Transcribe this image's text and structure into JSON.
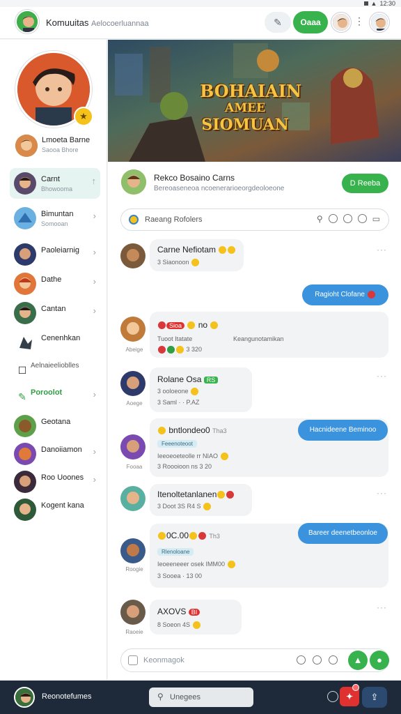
{
  "status": {
    "time": "12:30",
    "indicator": "▲"
  },
  "header": {
    "title": "Komuuitas",
    "subtitle": "Ael​ocoerluannaa",
    "pin_icon": "pin-icon",
    "green_button": "Oaaa"
  },
  "sidebar": {
    "profile_name": "Lmoeta Barne",
    "profile_sub": "Saooa Bhore",
    "items": [
      {
        "label": "Carnt",
        "sub": "Bhowooma"
      },
      {
        "label": "Bimuntan",
        "sub": "Somooan"
      },
      {
        "label": "Paoleiarnig",
        "sub": ""
      },
      {
        "label": "Dathe",
        "sub": ""
      },
      {
        "label": "Cantan",
        "sub": ""
      },
      {
        "label": "Cenenhkan",
        "sub": ""
      },
      {
        "label": "Aelnaieelioblles",
        "sub": ""
      },
      {
        "label": "Poroolot",
        "sub": ""
      },
      {
        "label": "Geotana",
        "sub": ""
      },
      {
        "label": "Danoiiamon",
        "sub": ""
      },
      {
        "label": "Roo Uoones",
        "sub": ""
      },
      {
        "label": "Kogent kana",
        "sub": ""
      }
    ]
  },
  "banner": {
    "l1": "BOHAIAIN",
    "l2": "AMEE",
    "l3": "SIOMUAN"
  },
  "group": {
    "name": "Rekco Bosaino Carns",
    "desc": "Bereoaseneoa ncoenerarioeorgdeoloeone",
    "join_label": "D Reeba"
  },
  "search": {
    "placeholder": "Raeang Rofolers"
  },
  "messages": [
    {
      "title": "Carne Nefiotam",
      "meta": "3 Siaonoon",
      "author": ""
    },
    {
      "title": "Sioa",
      "meta": "Tuoot Itatate",
      "extra": "Keangunotamikan",
      "meta2": "3 320",
      "author": "Abeige"
    },
    {
      "title": "Rolane Osa",
      "badge": "RS",
      "meta": "3 ooloeone",
      "meta2": "3 Saml · · P.AZ",
      "author": "Aoege"
    },
    {
      "title": "bntlondeo0",
      "side": "Tha3",
      "tag": "Feeenoteoot",
      "meta": "Ieeoeoeteolle rr NIAO",
      "meta2": "3 Roooioon ns 3 20",
      "author": "Fooaa"
    },
    {
      "title": "Itenoltetanlanen",
      "meta": "3 Doot 3S R4 S",
      "author": ""
    },
    {
      "title": "0C.00",
      "side": "Th3",
      "tag": "Rlenoloane",
      "meta": "Ieoeeneeer osek IMM00",
      "meta2": "3 Sooea · 13 00",
      "author": "Roogie"
    },
    {
      "title": "AXOVS",
      "badge": "BI",
      "meta": "8 Soeon 4S",
      "author": "Raoeie"
    }
  ],
  "blue_pills": [
    "Ragioht Clofane",
    "Hacnideene Beminoo",
    "Bareer deenetbeonloe"
  ],
  "composer": {
    "placeholder": "Keonmagok"
  },
  "bottom": {
    "name": "Reonotefumes",
    "search_placeholder": "Unegees"
  },
  "colors": {
    "accent": "#37b24d",
    "blue": "#3b93dd",
    "dark": "#1e2a3a"
  }
}
